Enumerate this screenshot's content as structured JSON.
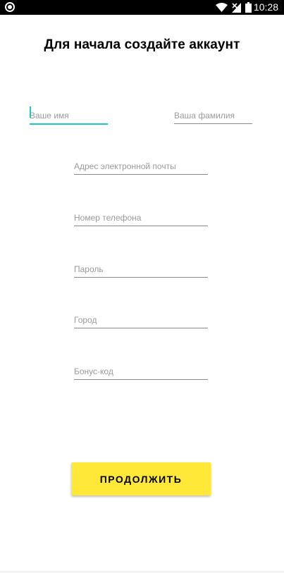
{
  "status_bar": {
    "time": "10:28",
    "icons": [
      "record-icon",
      "wifi-icon",
      "signal-no-service-icon",
      "battery-icon"
    ]
  },
  "title": "Для начала создайте аккаунт",
  "fields": {
    "first_name": {
      "placeholder": "Ваше имя",
      "value": ""
    },
    "last_name": {
      "placeholder": "Ваша фамилия",
      "value": ""
    },
    "email": {
      "placeholder": "Адрес электронной почты",
      "value": ""
    },
    "phone": {
      "placeholder": "Номер телефона",
      "value": ""
    },
    "password": {
      "placeholder": "Пароль",
      "value": ""
    },
    "city": {
      "placeholder": "Город",
      "value": ""
    },
    "bonus_code": {
      "placeholder": "Бонус-код",
      "value": ""
    }
  },
  "continue_button": {
    "label": "ПРОДОЛЖИТЬ"
  },
  "colors": {
    "accent": "#1ccac4",
    "button": "#ffe838",
    "status_bar": "#000000"
  }
}
